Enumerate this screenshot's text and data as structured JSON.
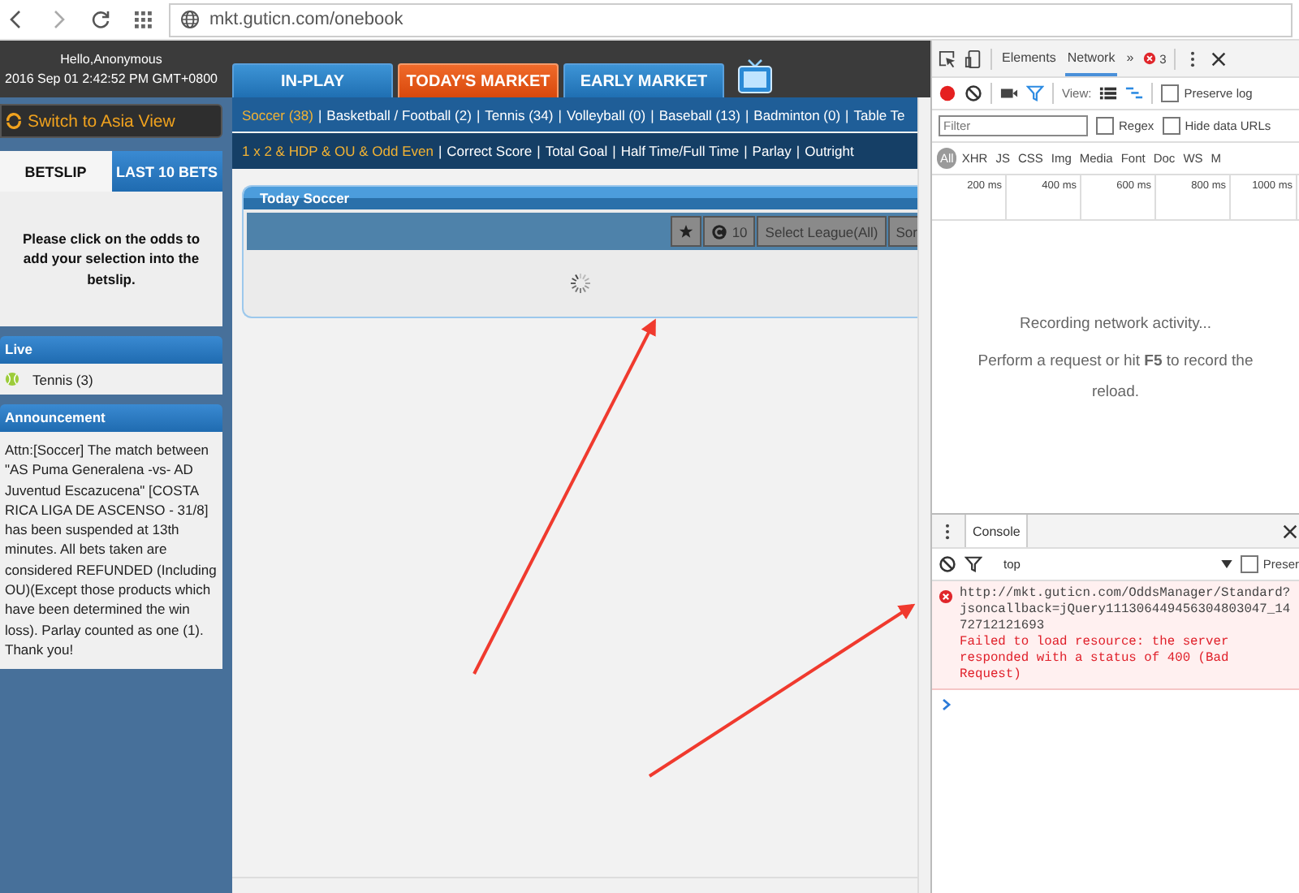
{
  "browser": {
    "url": "mkt.guticn.com/onebook"
  },
  "header": {
    "greeting": "Hello,Anonymous",
    "datetime": "2016 Sep 01 2:42:52 PM GMT+0800"
  },
  "market_tabs": [
    {
      "label": "IN-PLAY",
      "selected": false
    },
    {
      "label": "TODAY'S MARKET",
      "selected": true
    },
    {
      "label": "EARLY MARKET",
      "selected": false
    }
  ],
  "sidebar": {
    "switch_view": "Switch to Asia View",
    "betslip_tabs": [
      {
        "label": "BETSLIP",
        "selected": true
      },
      {
        "label": "LAST 10 BETS",
        "selected": false
      }
    ],
    "betslip_message": "Please click on the odds to add your selection into the betslip.",
    "live": {
      "title": "Live",
      "items": [
        {
          "label": "Tennis (3)"
        }
      ]
    },
    "announcement": {
      "title": "Announcement",
      "text": "Attn:[Soccer] The match between \"AS Puma Generalena -vs- AD Juventud Escazucena\" [COSTA RICA LIGA DE ASCENSO - 31/8] has been suspended at 13th minutes. All bets taken are considered REFUNDED (Including OU)(Except those products which have been determined the win loss). Parlay counted as one (1). Thank you!"
    }
  },
  "link_separator": "|",
  "sports": [
    {
      "label": "Soccer (38)",
      "selected": true
    },
    {
      "label": "Basketball / Football (2)",
      "selected": false
    },
    {
      "label": "Tennis (34)",
      "selected": false
    },
    {
      "label": "Volleyball (0)",
      "selected": false
    },
    {
      "label": "Baseball (13)",
      "selected": false
    },
    {
      "label": "Badminton (0)",
      "selected": false
    },
    {
      "label": "Table Te",
      "selected": false
    }
  ],
  "bet_types": [
    {
      "label": "1 x 2 & HDP & OU & Odd Even",
      "selected": true
    },
    {
      "label": "Correct Score",
      "selected": false
    },
    {
      "label": "Total Goal",
      "selected": false
    },
    {
      "label": "Half Time/Full Time",
      "selected": false
    },
    {
      "label": "Parlay",
      "selected": false
    },
    {
      "label": "Outright",
      "selected": false
    }
  ],
  "panel": {
    "title": "Today Soccer",
    "refresh_count": "10",
    "league_select": "Select League(All)",
    "sort": "Sor"
  },
  "devtools": {
    "tabs": [
      {
        "label": "Elements",
        "selected": false
      },
      {
        "label": "Network",
        "selected": true
      }
    ],
    "more": "»",
    "error_count": "3",
    "view_label": "View:",
    "preserve_log": {
      "label": "Preserve log",
      "checked": false
    },
    "filter": {
      "placeholder": "Filter"
    },
    "regex": {
      "label": "Regex",
      "checked": false
    },
    "hide_data_urls": {
      "label": "Hide data URLs",
      "checked": false
    },
    "type_filters": [
      {
        "label": "All",
        "selected": true
      },
      {
        "label": "XHR",
        "selected": false
      },
      {
        "label": "JS",
        "selected": false
      },
      {
        "label": "CSS",
        "selected": false
      },
      {
        "label": "Img",
        "selected": false
      },
      {
        "label": "Media",
        "selected": false
      },
      {
        "label": "Font",
        "selected": false
      },
      {
        "label": "Doc",
        "selected": false
      },
      {
        "label": "WS",
        "selected": false
      },
      {
        "label": "M",
        "selected": false
      }
    ],
    "timeline_ticks": [
      "200 ms",
      "400 ms",
      "600 ms",
      "800 ms",
      "1000 ms"
    ],
    "empty_title": "Recording network activity...",
    "empty_hint": "Perform a request or hit **F5** to record the reload."
  },
  "console": {
    "tab": "Console",
    "context": "top",
    "preserve": {
      "label": "Preser",
      "checked": false
    },
    "messages": [
      {
        "kind": "error",
        "url": "http://mkt.guticn.com/OddsManager/Standard?jsoncallback=jQuery111306449456304803047_1472712121693",
        "text": "Failed to load resource: the server responded with a status of 400 (Bad Request)"
      }
    ]
  }
}
